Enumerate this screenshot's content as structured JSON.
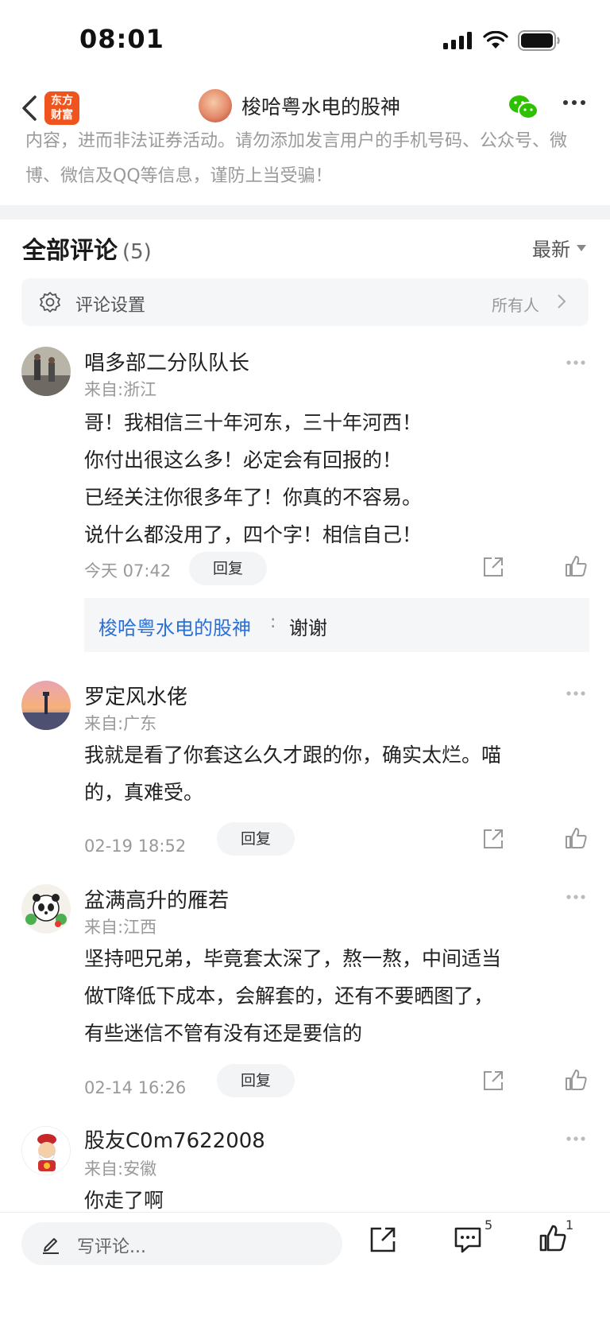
{
  "status_bar": {
    "time": "08:01"
  },
  "nav": {
    "app_logo_line1": "东方",
    "app_logo_line2": "财富",
    "title": "梭哈粤水电的股神"
  },
  "notice": {
    "text": "内容，进而非法证券活动。请勿添加发言用户的手机号码、公众号、微博、微信及QQ等信息，谨防上当受骗！"
  },
  "comments_header": {
    "title": "全部评论",
    "count": "(5)",
    "sort_label": "最新"
  },
  "settings": {
    "label": "评论设置",
    "value": "所有人"
  },
  "comments": [
    {
      "name": "唱多部二分队队长",
      "from": "来自:浙江",
      "lines": [
        "哥！我相信三十年河东，三十年河西！",
        "你付出很这么多！必定会有回报的！",
        "已经关注你很多年了！你真的不容易。",
        "说什么都没用了，四个字！相信自己！"
      ],
      "time": "今天 07:42",
      "reply_label": "回复",
      "reply": {
        "author": "梭哈粤水电的股神",
        "sep": ":",
        "text": "谢谢"
      }
    },
    {
      "name": "罗定风水佬",
      "from": "来自:广东",
      "lines": [
        "我就是看了你套这么久才跟的你，确实太烂。喵",
        "的，真难受。"
      ],
      "time": "02-19 18:52",
      "reply_label": "回复"
    },
    {
      "name": "盆满高升的雁若",
      "from": "来自:江西",
      "lines": [
        "坚持吧兄弟，毕竟套太深了，熬一熬，中间适当",
        "做T降低下成本，会解套的，还有不要晒图了，",
        "有些迷信不管有没有还是要信的"
      ],
      "time": "02-14 16:26",
      "reply_label": "回复"
    },
    {
      "name": "股友C0m7622008",
      "from": "来自:安徽",
      "lines": [
        "你走了啊"
      ]
    }
  ],
  "bottom_bar": {
    "placeholder": "写评论...",
    "comment_count": "5",
    "like_count": "1"
  },
  "colors": {
    "brand": "#f0541e",
    "link": "#2a6fd6",
    "wechat": "#2dc100"
  }
}
